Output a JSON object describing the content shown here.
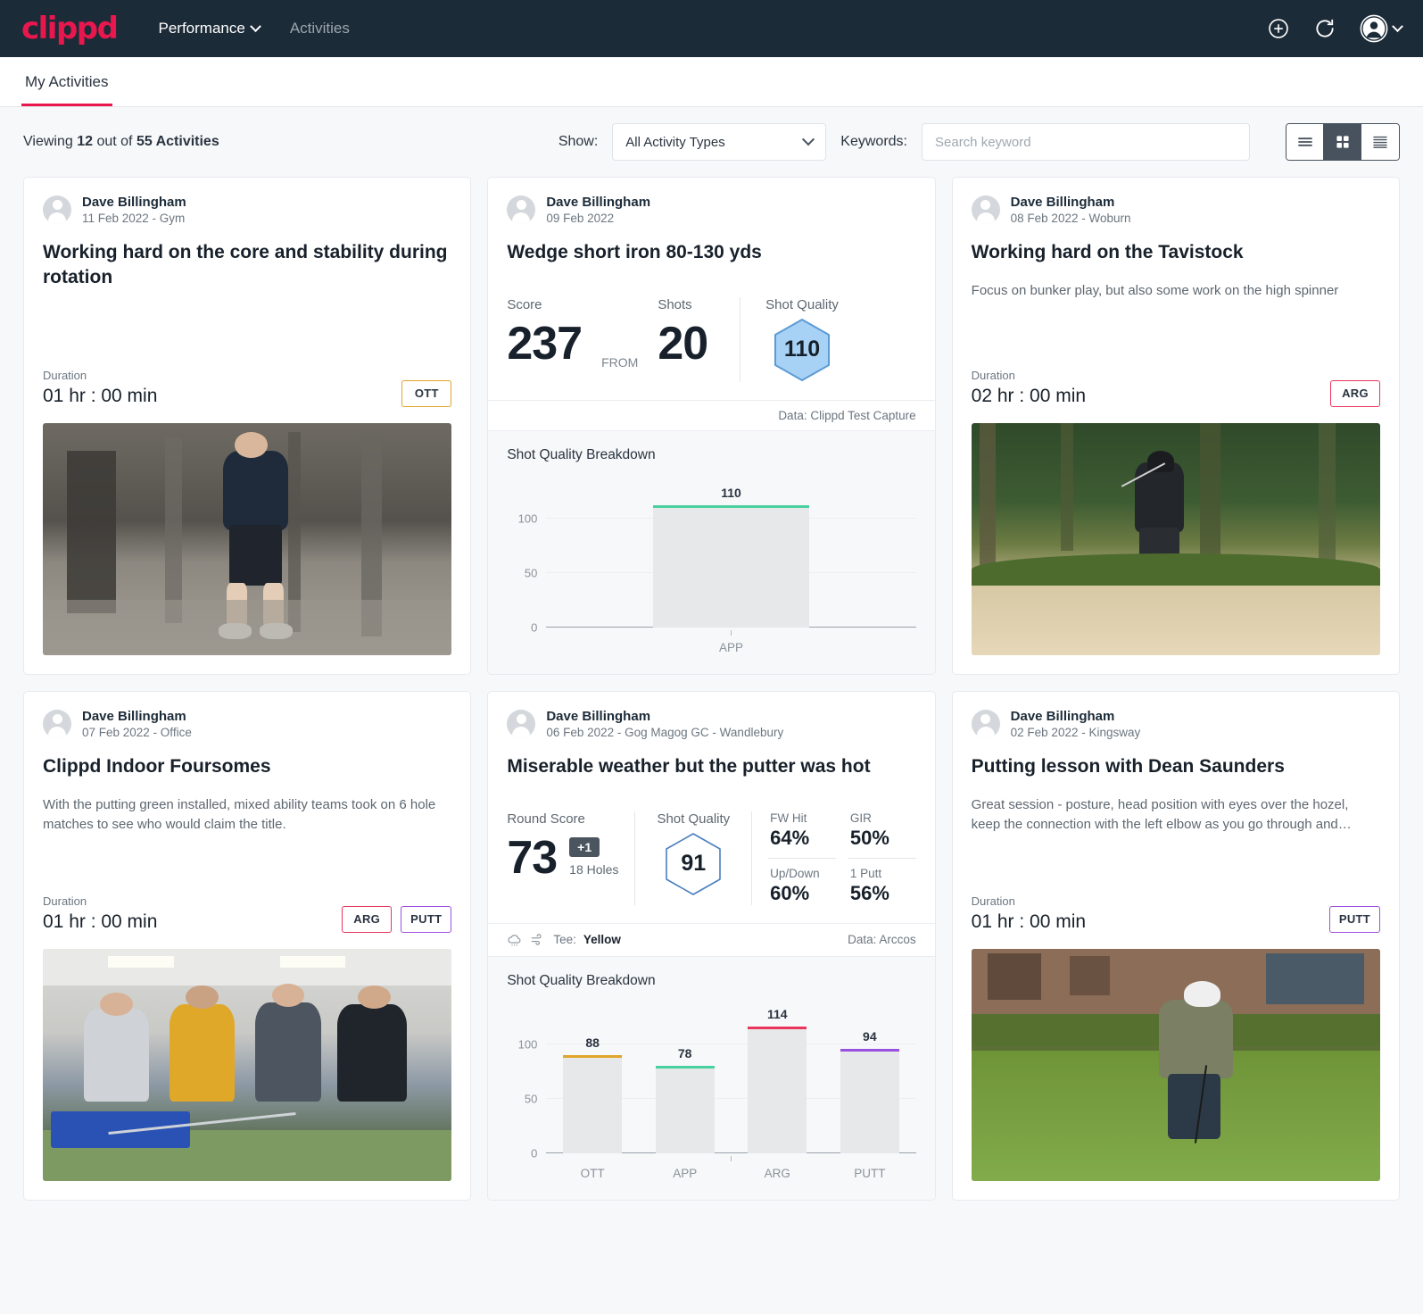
{
  "header": {
    "logo": "clippd",
    "nav": [
      {
        "label": "Performance",
        "has_chevron": true,
        "active": true
      },
      {
        "label": "Activities",
        "has_chevron": false,
        "active": false
      }
    ],
    "icons": [
      "add-circle-icon",
      "refresh-icon",
      "account-avatar-icon",
      "chevron-down-icon"
    ]
  },
  "tabs": [
    {
      "label": "My Activities",
      "active": true
    }
  ],
  "filters": {
    "viewing_prefix": "Viewing",
    "viewing_count": "12",
    "viewing_mid": "out of",
    "viewing_total": "55 Activities",
    "show_label": "Show:",
    "activity_type_value": "All Activity Types",
    "keywords_label": "Keywords:",
    "search_placeholder": "Search keyword",
    "search_value": "",
    "view_modes": [
      {
        "name": "list-view",
        "active": false
      },
      {
        "name": "grid-view",
        "active": true
      },
      {
        "name": "detail-view",
        "active": false
      }
    ]
  },
  "colors": {
    "brand": "#e8174e",
    "navbar": "#1c2b38",
    "ott": "#e0a52a",
    "app": "#4bd0a0",
    "arg": "#e8365d",
    "putt": "#9b51e0",
    "hex_fill": "#a8d2f5",
    "hex_stroke": "#5b9bd5",
    "hex_outline": "#4a7fbf"
  },
  "cards": [
    {
      "author": "Dave Billingham",
      "meta": "11 Feb 2022 - Gym",
      "title": "Working hard on the core and stability during rotation",
      "description": "",
      "duration_label": "Duration",
      "duration_value": "01 hr : 00 min",
      "badges": [
        {
          "label": "OTT",
          "color": "#e0a52a"
        }
      ],
      "media": "gym-video-thumbnail"
    },
    {
      "author": "Dave Billingham",
      "meta": "09 Feb 2022",
      "title": "Wedge short iron 80-130 yds",
      "stats": {
        "score_label": "Score",
        "score_value": "237",
        "from_label": "FROM",
        "shots_label": "Shots",
        "shots_value": "20",
        "quality_label": "Shot Quality",
        "quality_value": "110"
      },
      "footer_right": "Data: Clippd Test Capture",
      "chart_title": "Shot Quality Breakdown"
    },
    {
      "author": "Dave Billingham",
      "meta": "08 Feb 2022 - Woburn",
      "title": "Working hard on the Tavistock",
      "description": "Focus on bunker play, but also some work on the high spinner",
      "duration_label": "Duration",
      "duration_value": "02 hr : 00 min",
      "badges": [
        {
          "label": "ARG",
          "color": "#e8365d"
        }
      ],
      "media": "bunker-video-thumbnail"
    },
    {
      "author": "Dave Billingham",
      "meta": "07 Feb 2022 - Office",
      "title": "Clippd Indoor Foursomes",
      "description": "With the putting green installed, mixed ability teams took on 6 hole matches to see who would claim the title.",
      "duration_label": "Duration",
      "duration_value": "01 hr : 00 min",
      "badges": [
        {
          "label": "ARG",
          "color": "#e8365d"
        },
        {
          "label": "PUTT",
          "color": "#9b51e0"
        }
      ],
      "media": "indoor-foursomes-photo"
    },
    {
      "author": "Dave Billingham",
      "meta": "06 Feb 2022 - Gog Magog GC - Wandlebury",
      "title": "Miserable weather but the putter was hot",
      "stats": {
        "round_score_label": "Round Score",
        "round_score_value": "73",
        "to_par": "+1",
        "holes": "18 Holes",
        "quality_label": "Shot Quality",
        "quality_value": "91",
        "pcts": [
          {
            "label": "FW Hit",
            "value": "64%"
          },
          {
            "label": "GIR",
            "value": "50%"
          },
          {
            "label": "Up/Down",
            "value": "60%"
          },
          {
            "label": "1 Putt",
            "value": "56%"
          }
        ]
      },
      "footer_left_prefix": "Tee:",
      "footer_left_value": "Yellow",
      "footer_right": "Data: Arccos",
      "footer_icons": [
        "cloud-rain-icon",
        "wind-icon"
      ],
      "chart_title": "Shot Quality Breakdown"
    },
    {
      "author": "Dave Billingham",
      "meta": "02 Feb 2022 - Kingsway",
      "title": "Putting lesson with Dean Saunders",
      "description": "Great session - posture, head position with eyes over the hozel, keep the connection with the left elbow as you go through and…",
      "duration_label": "Duration",
      "duration_value": "01 hr : 00 min",
      "badges": [
        {
          "label": "PUTT",
          "color": "#9b51e0"
        }
      ],
      "media": "putting-lesson-photo"
    }
  ],
  "chart_data": [
    {
      "type": "bar",
      "title": "Shot Quality Breakdown",
      "categories": [
        "APP"
      ],
      "values": [
        110
      ],
      "bar_colors": [
        "#4bd0a0"
      ],
      "xlabel": "",
      "ylabel": "",
      "ylim": [
        0,
        125
      ],
      "yticks": [
        0,
        50,
        100
      ],
      "grid": true,
      "legend": "none"
    },
    {
      "type": "bar",
      "title": "Shot Quality Breakdown",
      "categories": [
        "OTT",
        "APP",
        "ARG",
        "PUTT"
      ],
      "values": [
        88,
        78,
        114,
        94
      ],
      "bar_colors": [
        "#e0a52a",
        "#4bd0a0",
        "#e8365d",
        "#9b51e0"
      ],
      "xlabel": "",
      "ylabel": "",
      "ylim": [
        0,
        125
      ],
      "yticks": [
        0,
        50,
        100
      ],
      "grid": true,
      "legend": "none"
    }
  ]
}
